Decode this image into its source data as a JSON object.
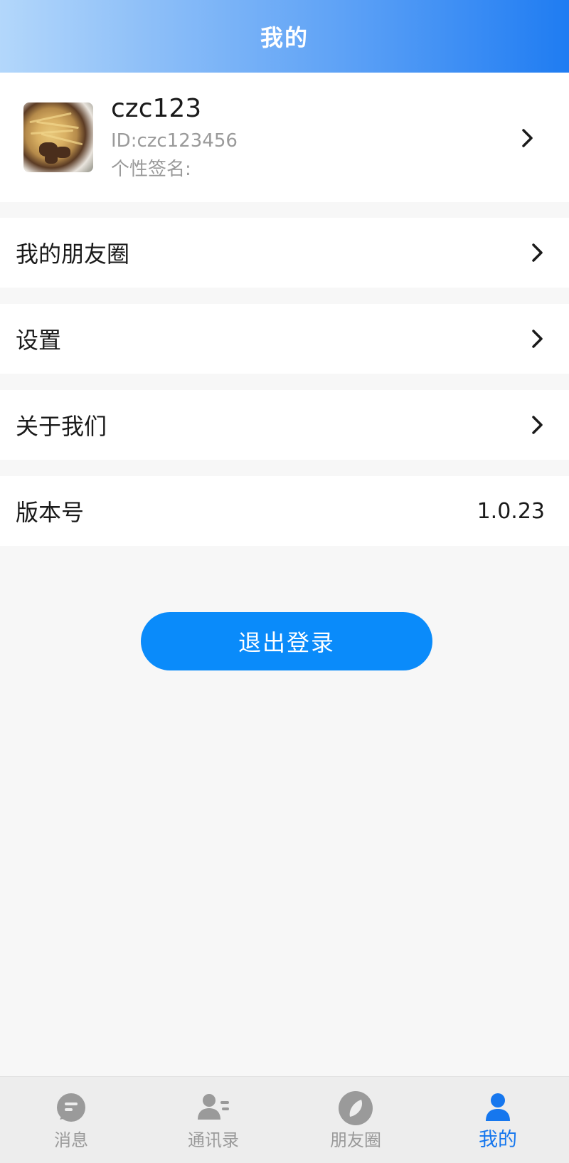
{
  "header": {
    "title": "我的"
  },
  "profile": {
    "username": "czc123",
    "user_id": "ID:czc123456",
    "signature_label": "个性签名:"
  },
  "menu": {
    "moments": "我的朋友圈",
    "settings": "设置",
    "about": "关于我们",
    "version_label": "版本号",
    "version_value": "1.0.23"
  },
  "logout": {
    "label": "退出登录"
  },
  "tabbar": {
    "tabs": [
      {
        "label": "消息",
        "icon": "message-icon"
      },
      {
        "label": "通讯录",
        "icon": "contacts-icon"
      },
      {
        "label": "朋友圈",
        "icon": "compass-icon"
      },
      {
        "label": "我的",
        "icon": "user-icon"
      }
    ],
    "active_index": 3
  },
  "colors": {
    "accent": "#1677ee",
    "button": "#0a8bfa",
    "inactive": "#9a9a9a"
  }
}
